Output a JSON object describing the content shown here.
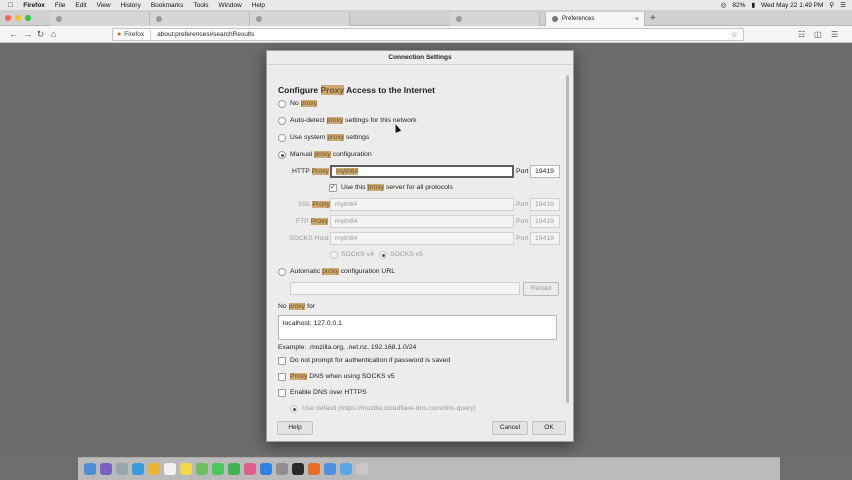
{
  "menubar": {
    "apple": "",
    "items": [
      "Firefox",
      "File",
      "Edit",
      "View",
      "History",
      "Bookmarks",
      "Tools",
      "Window",
      "Help"
    ],
    "battery": "82%",
    "clock": "Wed May 22 1:49 PM"
  },
  "tabs": [
    {
      "title": "",
      "active": false
    },
    {
      "title": "",
      "active": false
    },
    {
      "title": "",
      "active": false
    },
    {
      "title": "",
      "active": false
    },
    {
      "title": "Preferences",
      "active": true
    }
  ],
  "navbar": {
    "identity_label": "Firefox",
    "url": "about:preferences#searchResults"
  },
  "dialog": {
    "title": "Connection Settings",
    "heading_pre": "Configure ",
    "heading_hl": "Proxy",
    "heading_post": " Access to the Internet",
    "options": {
      "no_proxy": {
        "pre": "No ",
        "hl": "proxy",
        "post": ""
      },
      "auto_detect": {
        "pre": "Auto-detect ",
        "hl": "proxy",
        "post": " settings for this network"
      },
      "system": {
        "pre": "Use system ",
        "hl": "proxy",
        "post": " settings"
      },
      "manual": {
        "pre": "Manual ",
        "hl": "proxy",
        "post": " configuration"
      },
      "auto_url": {
        "pre": "Automatic ",
        "hl": "proxy",
        "post": " configuration URL"
      }
    },
    "selected_option": "manual",
    "http": {
      "label_pre": "HTTP ",
      "label_hl": "Proxy",
      "value": "myth64",
      "port_label": "Port",
      "port": "19419"
    },
    "use_all": {
      "pre": "Use this ",
      "hl": "proxy",
      "post": " server for all protocols",
      "checked": true
    },
    "ssl": {
      "label_pre": "SSL ",
      "label_hl": "Proxy",
      "value": "myth64",
      "port_label": "Port",
      "port": "19419"
    },
    "ftp": {
      "label_pre": "FTP ",
      "label_hl": "Proxy",
      "value": "myth64",
      "port_label": "Port",
      "port": "19419"
    },
    "socks": {
      "label": "SOCKS Host",
      "value": "myth64",
      "port_label": "Port",
      "port": "19419"
    },
    "socks_v4": "SOCKS v4",
    "socks_v5": "SOCKS v5",
    "reload": "Reload",
    "no_proxy_for": {
      "pre": "No ",
      "hl": "proxy",
      "post": " for"
    },
    "no_proxy_value": "localhost, 127.0.0.1",
    "example": "Example: .mozilla.org, .net.nz, 192.168.1.0/24",
    "no_prompt": "Do not prompt for authentication if password is saved",
    "proxy_dns": {
      "hl": "Proxy",
      "post": " DNS when using SOCKS v5"
    },
    "dns_https": "Enable DNS over HTTPS",
    "use_default": "Use default (https://mozilla.cloudflare-dns.com/dns-query)",
    "buttons": {
      "help": "Help",
      "cancel": "Cancel",
      "ok": "OK"
    }
  },
  "colors": {
    "highlight": "#cda973",
    "overlay": "#6c6c6c",
    "traffic_red": "#fc5f57",
    "traffic_yellow": "#fdbc2e",
    "traffic_green": "#28c840"
  },
  "dock": {
    "icons": [
      "finder-icon",
      "siri-icon",
      "launchpad-icon",
      "safari-icon",
      "photos-icon",
      "calendar-icon",
      "notes-icon",
      "maps-icon",
      "messages-icon",
      "facetime-icon",
      "itunes-icon",
      "appstore-icon",
      "settings-icon",
      "terminal-icon",
      "firefox-icon",
      "chrome-icon",
      "folder-icon",
      "trash-icon"
    ]
  }
}
